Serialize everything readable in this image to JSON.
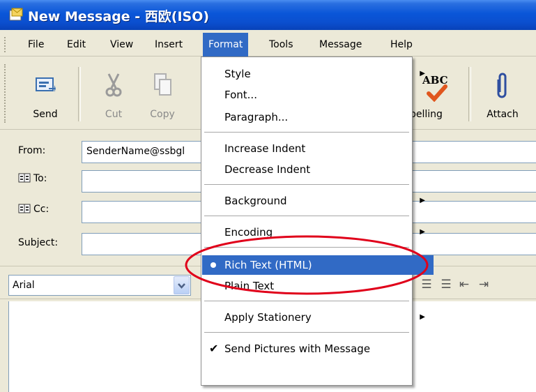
{
  "window": {
    "title": "New Message - 西欧(ISO)"
  },
  "menubar": {
    "items": [
      "File",
      "Edit",
      "View",
      "Insert",
      "Format",
      "Tools",
      "Message",
      "Help"
    ]
  },
  "toolbar": {
    "send": "Send",
    "cut": "Cut",
    "copy": "Copy",
    "spelling": "pelling",
    "spelling_icon_text": "ABC",
    "attach": "Attach"
  },
  "headers": {
    "from_label": "From:",
    "from_value": "SenderName@ssbgl",
    "to_label": "To:",
    "cc_label": "Cc:",
    "subject_label": "Subject:"
  },
  "format_bar": {
    "font": "Arial"
  },
  "format_menu": {
    "style": "Style",
    "font": "Font...",
    "paragraph": "Paragraph...",
    "increase_indent": "Increase Indent",
    "decrease_indent": "Decrease Indent",
    "background": "Background",
    "encoding": "Encoding",
    "rich_text": "Rich Text (HTML)",
    "plain_text": "Plain Text",
    "apply_stationery": "Apply Stationery",
    "send_pictures": "Send Pictures with Message"
  },
  "colors": {
    "title_blue": "#0a56d8",
    "highlight": "#316ac5",
    "annotation_red": "#e0001a"
  }
}
